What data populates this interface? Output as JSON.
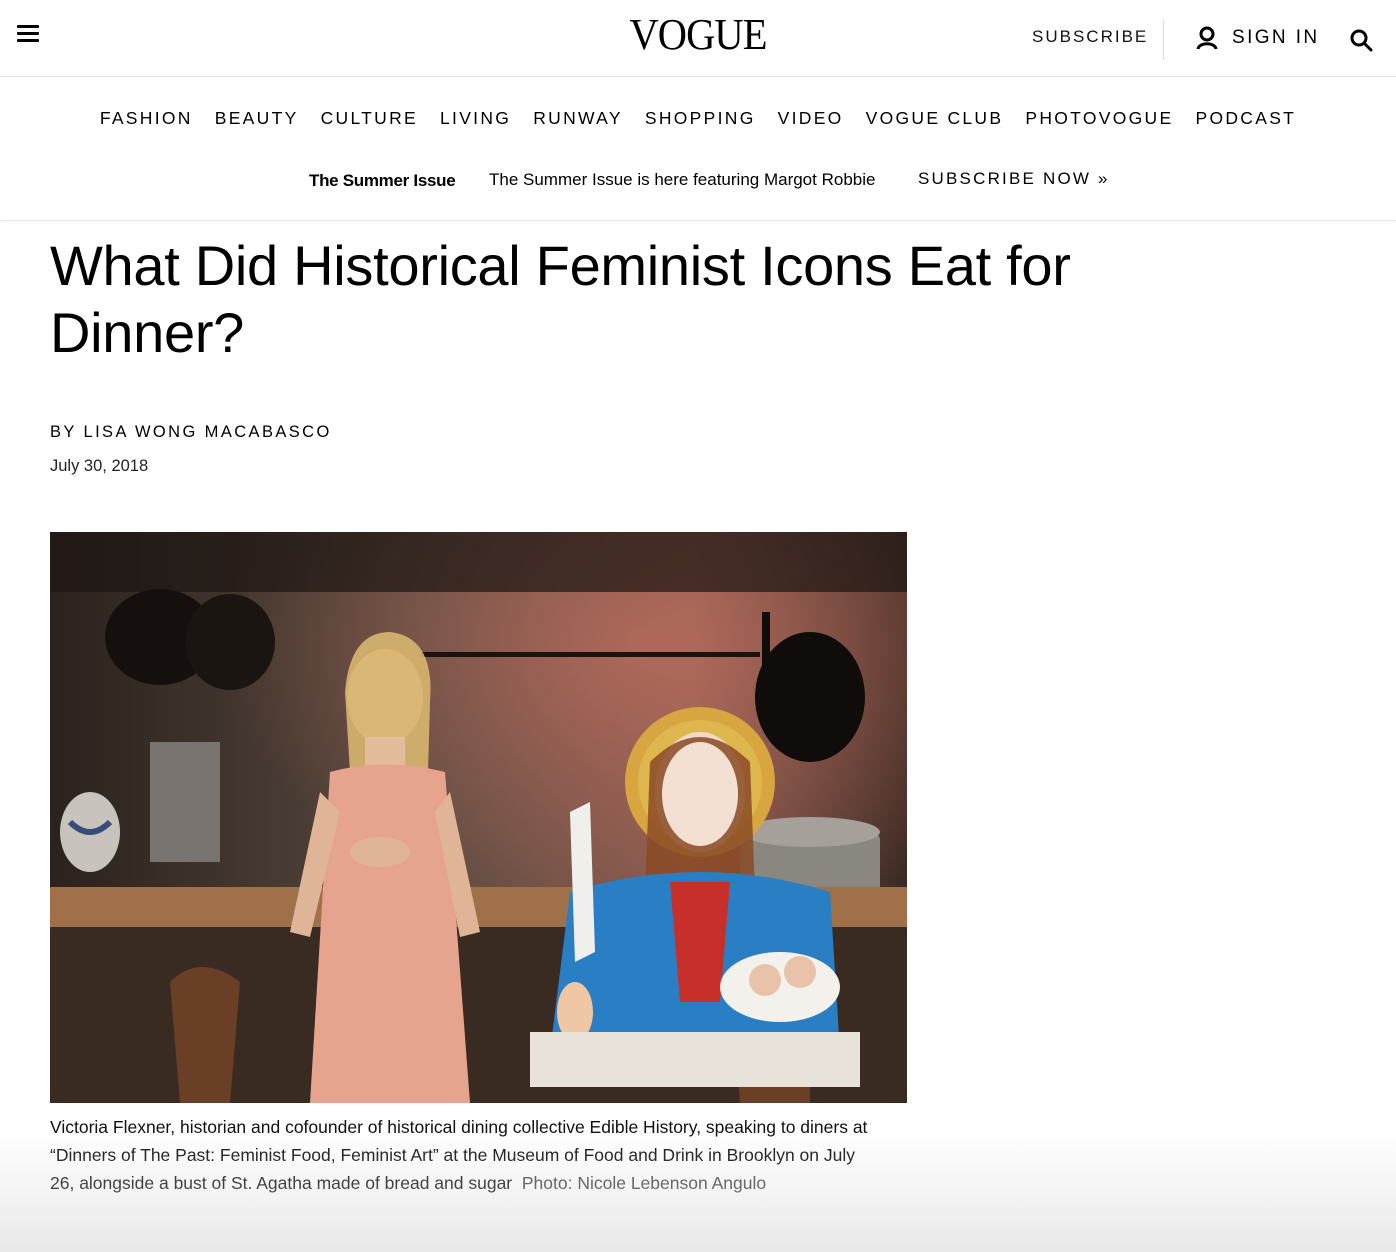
{
  "header": {
    "logo": "VOGUE",
    "subscribe": "SUBSCRIBE",
    "sign_in": "SIGN IN"
  },
  "nav": {
    "items": [
      "FASHION",
      "BEAUTY",
      "CULTURE",
      "LIVING",
      "RUNWAY",
      "SHOPPING",
      "VIDEO",
      "VOGUE CLUB",
      "PHOTOVOGUE",
      "PODCAST"
    ]
  },
  "promo": {
    "issue_label": "The Summer Issue",
    "text": "The Summer Issue is here featuring Margot Robbie",
    "cta": "SUBSCRIBE NOW »"
  },
  "article": {
    "headline": "What Did Historical Feminist Icons Eat for Dinner?",
    "byline": "BY LISA WONG MACABASCO",
    "date": "July 30, 2018",
    "caption": "Victoria Flexner, historian and cofounder of historical dining collective Edible History, speaking to diners at “Dinners of The Past: Feminist Food, Feminist Art” at the Museum of Food and Drink in Brooklyn on July 26, alongside a bust of St. Agatha made of bread and sugar",
    "photo_credit": "Photo: Nicole Lebenson Angulo"
  },
  "icons": {
    "menu": "hamburger-menu-icon",
    "account": "user-icon",
    "search": "search-icon"
  }
}
